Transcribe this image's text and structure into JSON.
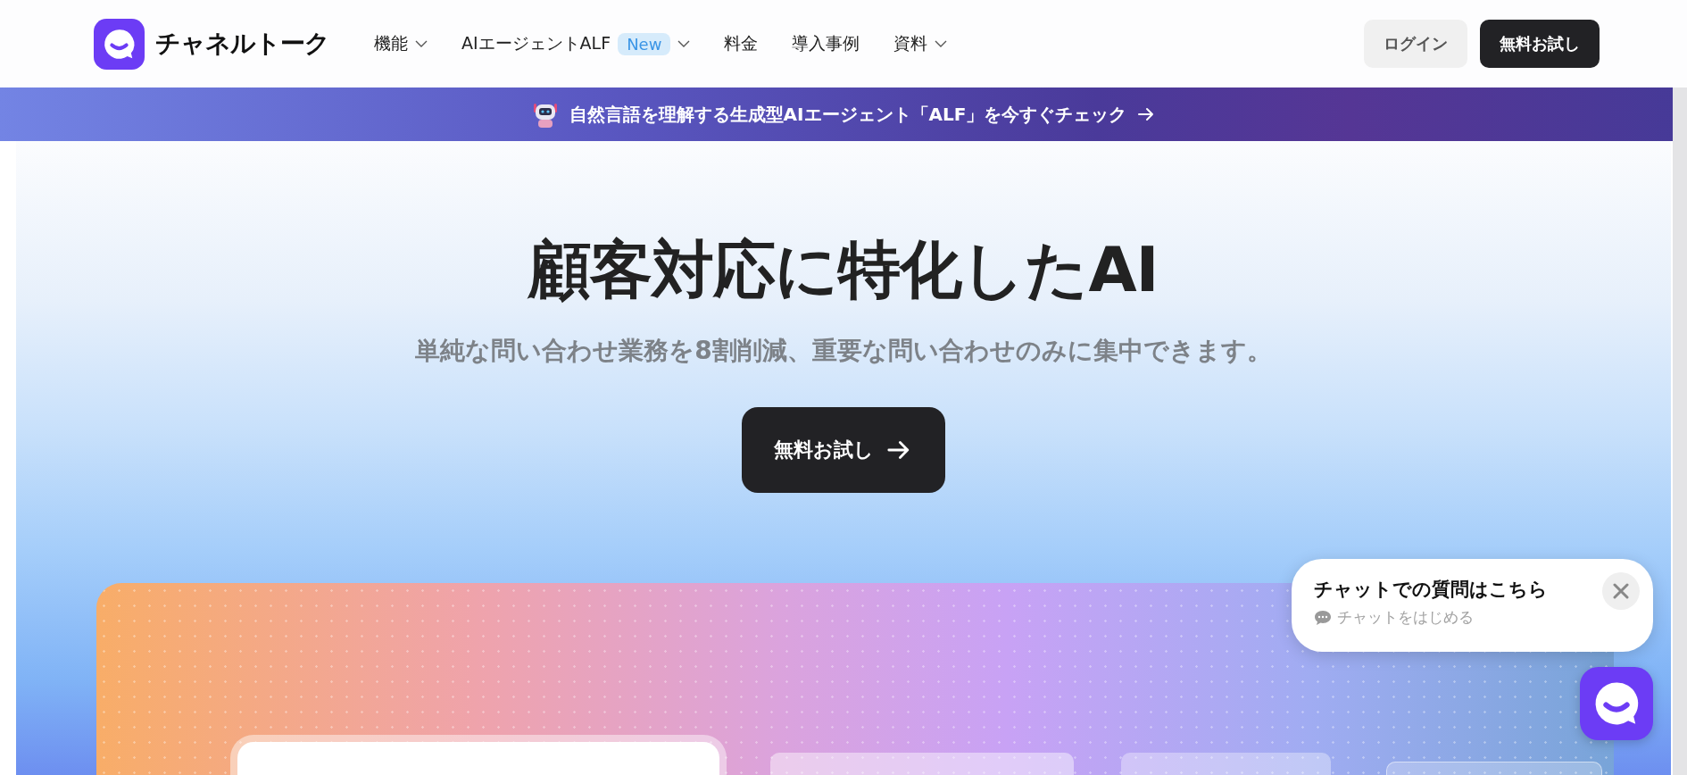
{
  "logo": {
    "name": "チャネルトーク"
  },
  "nav": [
    {
      "label": "機能",
      "dropdown": true
    },
    {
      "label": "AIエージェントALF",
      "badge": "New",
      "dropdown": true
    },
    {
      "label": "料金",
      "dropdown": false
    },
    {
      "label": "導入事例",
      "dropdown": false
    },
    {
      "label": "資料",
      "dropdown": true
    }
  ],
  "header_buttons": [
    {
      "label": "ログイン",
      "kind": "secondary"
    },
    {
      "label": "無料お試し",
      "kind": "primary"
    }
  ],
  "announcement": {
    "text": "自然言語を理解する生成型AIエージェント「ALF」を今すぐチェック"
  },
  "hero": {
    "title": "顧客対応に特化したAI",
    "subtitle": "単純な問い合わせ業務を8割削減、重要な問い合わせのみに集中できます。",
    "cta": "無料お試し"
  },
  "chat_popup": {
    "title": "チャットでの質問はこちら",
    "action": "チャットをはじめる"
  }
}
